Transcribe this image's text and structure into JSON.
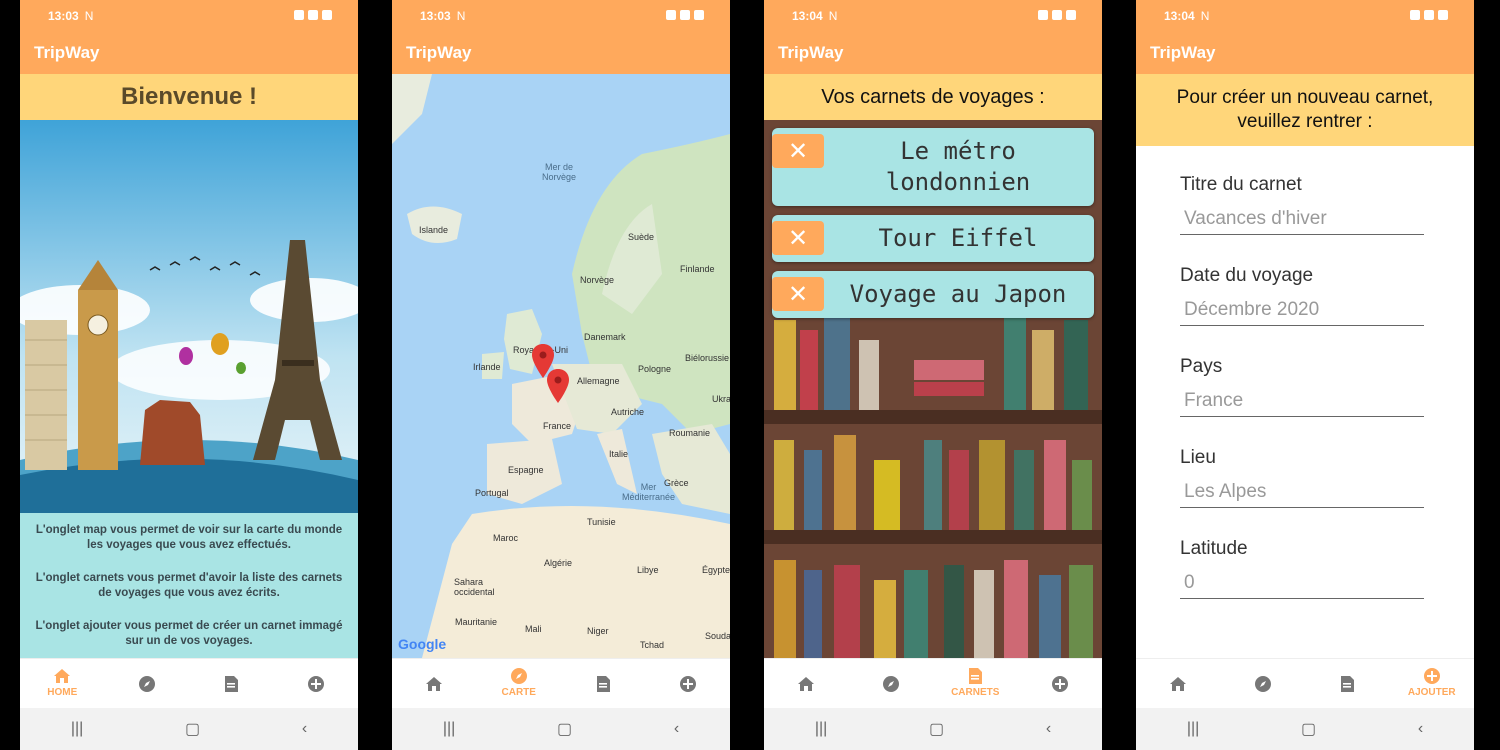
{
  "app_title": "TripWay",
  "screens": [
    {
      "time": "13:03",
      "status_marks": "N"
    },
    {
      "time": "13:03",
      "status_marks": "N"
    },
    {
      "time": "13:04",
      "status_marks": "N"
    },
    {
      "time": "13:04",
      "status_marks": "N"
    }
  ],
  "home": {
    "title": "Bienvenue !",
    "paragraphs": [
      "L'onglet map vous permet de voir sur la carte du monde les voyages que vous avez effectués.",
      "L'onglet carnets vous permet d'avoir la liste des carnets de voyages que vous avez écrits.",
      "L'onglet ajouter vous permet de créer un carnet immagé sur un de vos voyages."
    ]
  },
  "map": {
    "labels": {
      "sea_north": "Mer de\nNorvège",
      "iceland": "Islande",
      "sweden": "Suède",
      "finland": "Finlande",
      "norway": "Norvège",
      "denmark": "Danemark",
      "uk": "Royaume-Uni",
      "ireland": "Irlande",
      "belarus": "Biélorussie",
      "poland": "Pologne",
      "germany": "Allemagne",
      "ukraine": "Ukra",
      "austria": "Autriche",
      "france": "France",
      "romania": "Roumanie",
      "italy": "Italie",
      "spain": "Espagne",
      "portugal": "Portugal",
      "greece": "Grèce",
      "sea_med": "Mer\nMéditerranée",
      "tunisia": "Tunisie",
      "morocco": "Maroc",
      "algeria": "Algérie",
      "libya": "Libye",
      "egypt": "Égypte",
      "wsahara": "Sahara\noccidental",
      "mauritania": "Mauritanie",
      "mali": "Mali",
      "niger": "Niger",
      "chad": "Tchad",
      "sudan": "Souda"
    },
    "attribution": "Google"
  },
  "carnets": {
    "title": "Vos carnets de voyages :",
    "delete_symbol": "✕",
    "items": [
      "Le métro\nlondonnien",
      "Tour Eiffel",
      "Voyage au Japon"
    ]
  },
  "ajouter": {
    "title_line1": "Pour créer un nouveau carnet,",
    "title_line2": "veuillez rentrer :",
    "fields": [
      {
        "label": "Titre du carnet",
        "placeholder": "Vacances d'hiver"
      },
      {
        "label": "Date du voyage",
        "placeholder": "Décembre 2020"
      },
      {
        "label": "Pays",
        "placeholder": "France"
      },
      {
        "label": "Lieu",
        "placeholder": "Les Alpes"
      },
      {
        "label": "Latitude",
        "placeholder": "0"
      }
    ]
  },
  "nav": {
    "home": "HOME",
    "carte": "CARTE",
    "carnets": "CARNETS",
    "ajouter": "AJOUTER"
  },
  "colors": {
    "primary": "#ffa95c",
    "banner": "#ffd67a",
    "accent_panel": "#a9e4e4",
    "sea": "#a9d3f5",
    "marker": "#e53935"
  }
}
